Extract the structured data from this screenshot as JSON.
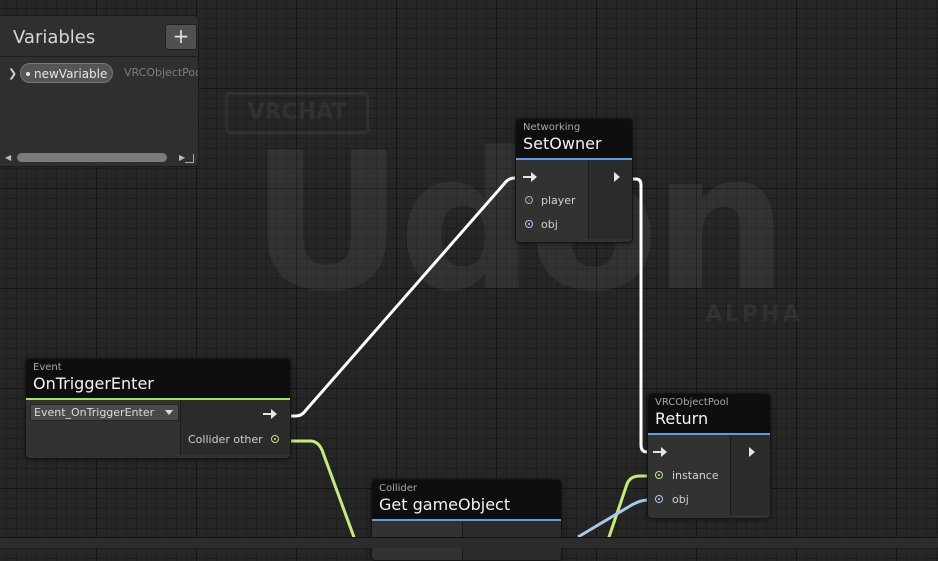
{
  "variables_panel": {
    "title": "Variables",
    "add_label": "+",
    "variable": {
      "name": "newVariable",
      "type": "VRCObjectPool"
    }
  },
  "nodes": {
    "set_owner": {
      "category": "Networking",
      "title": "SetOwner",
      "inputs": [
        "player",
        "obj"
      ]
    },
    "on_trigger_enter": {
      "category": "Event",
      "title": "OnTriggerEnter",
      "dropdown_value": "Event_OnTriggerEnter",
      "output": "Collider other"
    },
    "return": {
      "category": "VRCObjectPool",
      "title": "Return",
      "inputs": [
        "instance",
        "obj"
      ]
    },
    "get_game_object": {
      "category": "Collider",
      "title": "Get gameObject"
    }
  },
  "colors": {
    "flow_wire": "#ffffff",
    "collider_wire": "#c5ec7a",
    "object_wire": "#a7c9e4",
    "event_accent": "#9ee36a",
    "function_accent": "#5e9de0",
    "background": "#262626"
  },
  "icons": [
    "plus-icon",
    "chevron-right-icon",
    "dropdown-caret-icon",
    "flow-arrow-icon",
    "port-dot-icon"
  ],
  "watermark": {
    "badge": "VRCHAT",
    "word": "Udon",
    "tag": "ALPHA"
  }
}
